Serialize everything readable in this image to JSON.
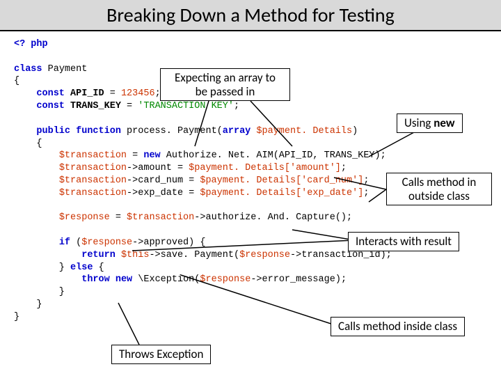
{
  "title": "Breaking Down a Method for Testing",
  "code": {
    "open": "<? php",
    "class_kw": "class",
    "class_name": "Payment",
    "const1_kw": "const",
    "const1_name": "API_ID",
    "const1_val": "123456",
    "const2_kw": "const",
    "const2_name": "TRANS_KEY",
    "const2_val": "'TRANSACTION KEY'",
    "pub": "public",
    "func": "function",
    "method": "process. Payment",
    "arr": "array",
    "param": "$payment. Details",
    "tx": "$transaction",
    "new": "new",
    "aim": "Authorize. Net. AIM",
    "args": "(API_ID, TRANS_KEY)",
    "amount": "amount",
    "pd_amount": "$payment. Details['amount']",
    "cardnum": "card_num",
    "pd_card": "$payment. Details['card_num']",
    "expdate": "exp_date",
    "pd_exp": "$payment. Details['exp_date']",
    "resp": "$response",
    "auth": "authorize. And. Capture",
    "if": "if",
    "approved": "approved",
    "return": "return",
    "this": "$this",
    "save": "save. Payment",
    "tid": "transaction_id",
    "else": "else",
    "throw": "throw",
    "new2": "new",
    "exc": "\\Exception",
    "errmsg": "error_message"
  },
  "callouts": {
    "c1a": "Expecting an array to",
    "c1b": "be passed in",
    "c2a": "Using ",
    "c2b": "new",
    "c3a": "Calls method in",
    "c3b": "outside class",
    "c4": "Interacts with result",
    "c5": "Calls method inside class",
    "c6": "Throws Exception"
  }
}
